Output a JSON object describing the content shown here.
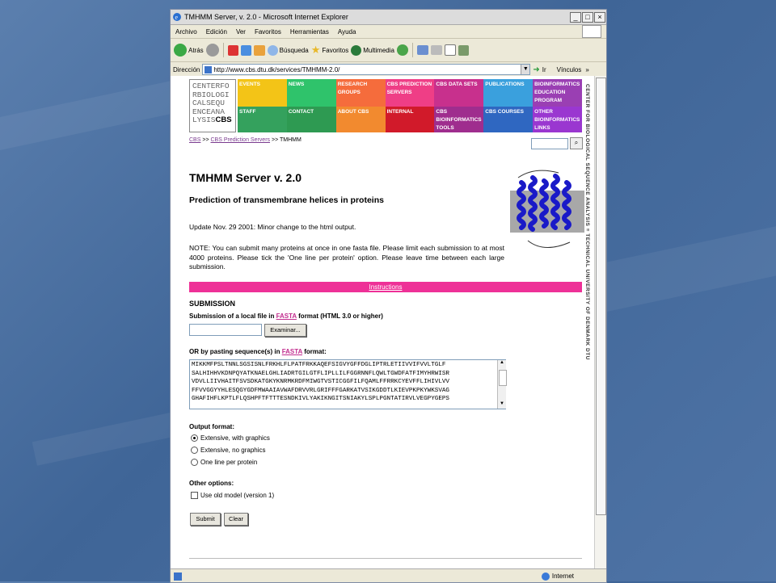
{
  "window": {
    "title": "TMHMM Server, v. 2.0 - Microsoft Internet Explorer",
    "controls": [
      "_",
      "□",
      "×"
    ]
  },
  "menu": [
    "Archivo",
    "Edición",
    "Ver",
    "Favoritos",
    "Herramientas",
    "Ayuda"
  ],
  "toolbar": {
    "back": "Atrás",
    "search": "Búsqueda",
    "favorites": "Favoritos",
    "multimedia": "Multimedia"
  },
  "address": {
    "label": "Dirección",
    "url": "http://www.cbs.dtu.dk/services/TMHMM-2.0/",
    "go": "Ir",
    "links": "Vínculos"
  },
  "logo": {
    "lines": [
      "CENTERFO",
      "RBIOLOGI",
      "CALSEQU",
      "ENCEANA",
      "LYSIS"
    ],
    "abbr": "CBS"
  },
  "nav": [
    {
      "label": "EVENTS",
      "color": "#f3c417"
    },
    {
      "label": "NEWS",
      "color": "#2fc36b"
    },
    {
      "label": "RESEARCH GROUPS",
      "color": "#f56c3c"
    },
    {
      "label": "CBS PREDICTION SERVERS",
      "color": "#ef3e86"
    },
    {
      "label": "CBS DATA SETS",
      "color": "#c8308d"
    },
    {
      "label": "PUBLICATIONS",
      "color": "#3aa0dd"
    },
    {
      "label": "BIOINFORMATICS EDUCATION PROGRAM",
      "color": "#9a3fb3"
    },
    {
      "label": "STAFF",
      "color": "#34a15d"
    },
    {
      "label": "CONTACT",
      "color": "#2e9a52"
    },
    {
      "label": "ABOUT CBS",
      "color": "#f28a2f"
    },
    {
      "label": "INTERNAL",
      "color": "#d11a2a"
    },
    {
      "label": "CBS BIOINFORMATICS TOOLS",
      "color": "#9f2d8e"
    },
    {
      "label": "CBS COURSES",
      "color": "#2f67c1"
    },
    {
      "label": "OTHER BIOINFORMATICS LINKS",
      "color": "#9a37d0"
    }
  ],
  "side_text": "CENTER FOR BIOLOGICAL SEQUENCE ANALYSIS ≡ TECHNICAL UNIVERSITY OF DENMARK DTU",
  "breadcrumb": {
    "home": "CBS",
    "sep1": ">>",
    "servers": "CBS Prediction Servers",
    "sep2": ">>",
    "current": "TMHMM"
  },
  "page": {
    "title": "TMHMM Server v. 2.0",
    "subtitle": "Prediction of transmembrane helices in proteins",
    "update": "Update Nov. 29 2001: Minor change to the html output.",
    "note": "NOTE: You can submit many proteins at once in one fasta file. Please limit each submission to at most 4000 proteins. Please tick the 'One line per protein' option. Please leave time between each large submission.",
    "instructions": "Instructions"
  },
  "submission": {
    "heading": "SUBMISSION",
    "file_label_pre": "Submission of a local file in ",
    "fasta": "FASTA",
    "file_label_post": " format (HTML 3.0 or higher)",
    "browse": "Examinar...",
    "paste_label_pre": "OR by pasting sequence(s) in ",
    "paste_label_post": " format:",
    "sequence": "MIKKMFPSLTNNLSGSISNLFRKHLFLPATFRKKAQEFSIGVYGFFDGLIPTRLETIIVVIFVVLTGLF\nSALHIHHVKDNPQYATKNAELGHLIADRTGILGTFLIPLLILFGGRNNFLQWLTGWDFATFIMYHRWISR\nVDVLLIIVHAITFSVSDKATGKYKNRMKRDFMIWGTVSTICGGFILFQAMLFFRRKCYEVFFLIHIVLVV\nFFVVGGYYHLESQGYGDFMWAAIAVWAFDRVVRLGRIFFFGARKATVSIKGDDTLKIEVPKPKYWKSVAG\nGHAFIHFLKPTLFLQSHPFTFTTTESNDKIVLYAKIKNGITSNIAKYLSPLPGNTATIRVLVEGPYGEPS"
  },
  "output": {
    "heading": "Output format:",
    "options": [
      "Extensive, with graphics",
      "Extensive, no graphics",
      "One line per protein"
    ],
    "selected": 0
  },
  "other": {
    "heading": "Other options:",
    "old_model": "Use old model (version 1)"
  },
  "buttons": {
    "submit": "Submit",
    "clear": "Clear"
  },
  "status": {
    "zone": "Internet"
  }
}
